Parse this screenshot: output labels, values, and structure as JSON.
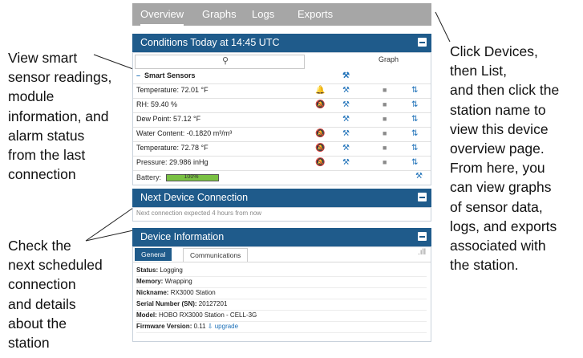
{
  "callouts": {
    "left_top": "View smart\nsensor readings,\nmodule\ninformation, and\nalarm status\nfrom the last\nconnection",
    "left_bottom": "Check the\nnext scheduled\nconnection\nand details\nabout the\nstation",
    "right": "Click Devices,\nthen List,\nand then click the\nstation name to\nview this device\noverview page.\nFrom here, you\ncan view graphs\nof sensor data,\nlogs, and exports\nassociated with\nthe station."
  },
  "nav": {
    "tabs": [
      "Overview",
      "Graphs",
      "Logs",
      "Exports"
    ],
    "active": "Overview"
  },
  "conditions": {
    "title": "Conditions Today at 14:45 UTC",
    "graph_header": "Graph",
    "section": "Smart Sensors",
    "rows": [
      {
        "label": "Temperature: 72.01 °F",
        "alarm": "active"
      },
      {
        "label": "RH: 59.40 %",
        "alarm": "off"
      },
      {
        "label": "Dew Point: 57.12 °F",
        "alarm": "none"
      },
      {
        "label": "Water Content: -0.1820 m³/m³",
        "alarm": "off"
      },
      {
        "label": "Temperature: 72.78 °F",
        "alarm": "off"
      },
      {
        "label": "Pressure: 29.986 inHg",
        "alarm": "off"
      }
    ],
    "battery_label": "Battery:",
    "battery_text": "100%",
    "battery_level": 1.0
  },
  "next": {
    "title": "Next Device Connection",
    "text": "Next connection expected 4 hours from now"
  },
  "device": {
    "title": "Device Information",
    "tabs": [
      "General",
      "Communications"
    ],
    "fields": [
      {
        "k": "Status:",
        "v": " Logging"
      },
      {
        "k": "Memory:",
        "v": " Wrapping"
      },
      {
        "k": "Nickname:",
        "v": " RX3000 Station"
      },
      {
        "k": "Serial Number (SN):",
        "v": " 20127201"
      },
      {
        "k": "Model:",
        "v": " HOBO RX3000 Station - CELL-3G"
      },
      {
        "k": "Firmware Version:",
        "v": " 0.11 "
      }
    ],
    "upgrade": "upgrade"
  },
  "colors": {
    "header": "#1f5b8b",
    "tabbar": "#a6a6a6",
    "battery": "#7ac143"
  }
}
